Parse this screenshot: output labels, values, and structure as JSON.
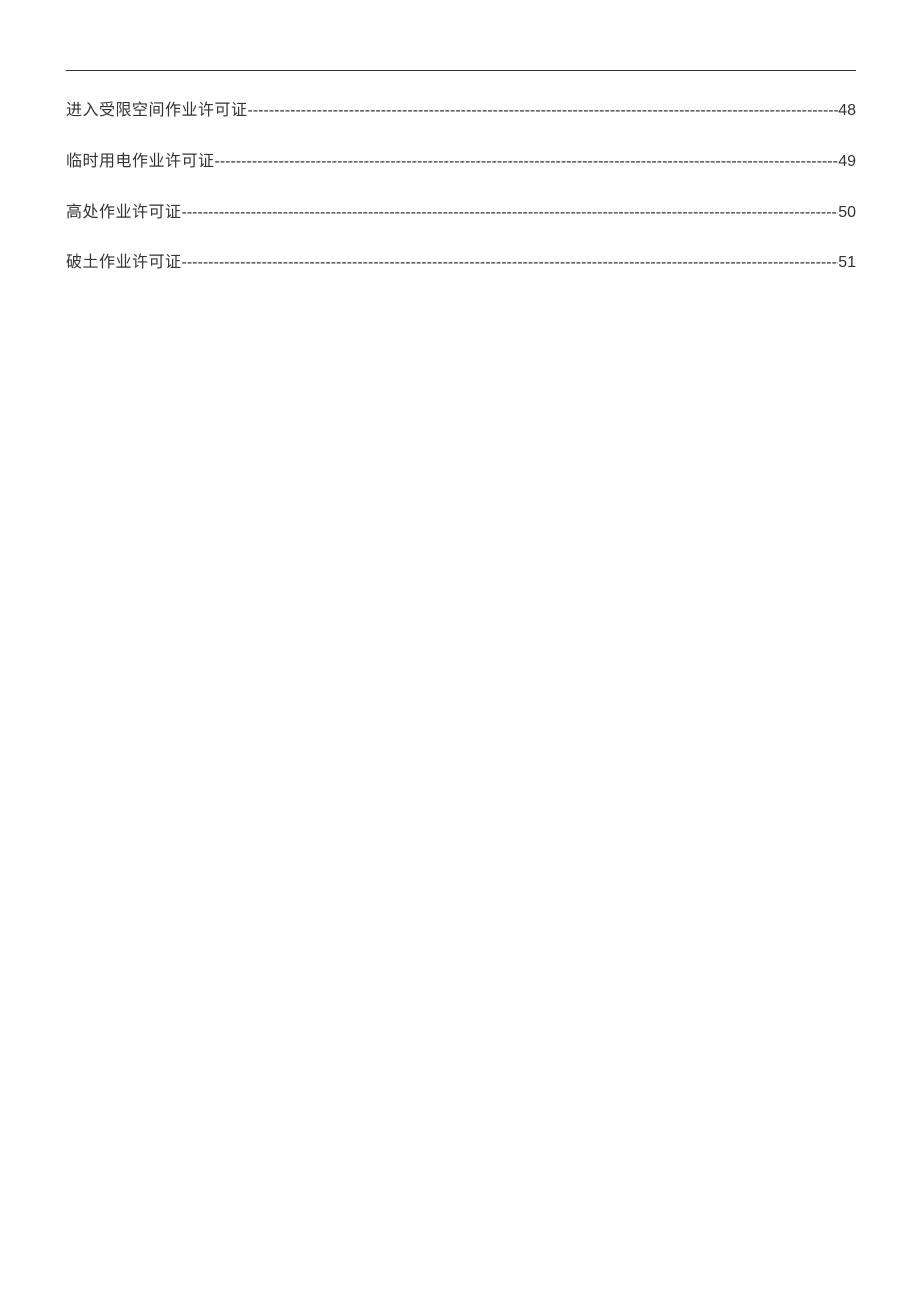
{
  "toc": {
    "entries": [
      {
        "title": "进入受限空间作业许可证",
        "page": "48"
      },
      {
        "title": "临时用电作业许可证",
        "page": "49"
      },
      {
        "title": "高处作业许可证",
        "page": "50"
      },
      {
        "title": "破土作业许可证",
        "page": "51"
      }
    ]
  }
}
